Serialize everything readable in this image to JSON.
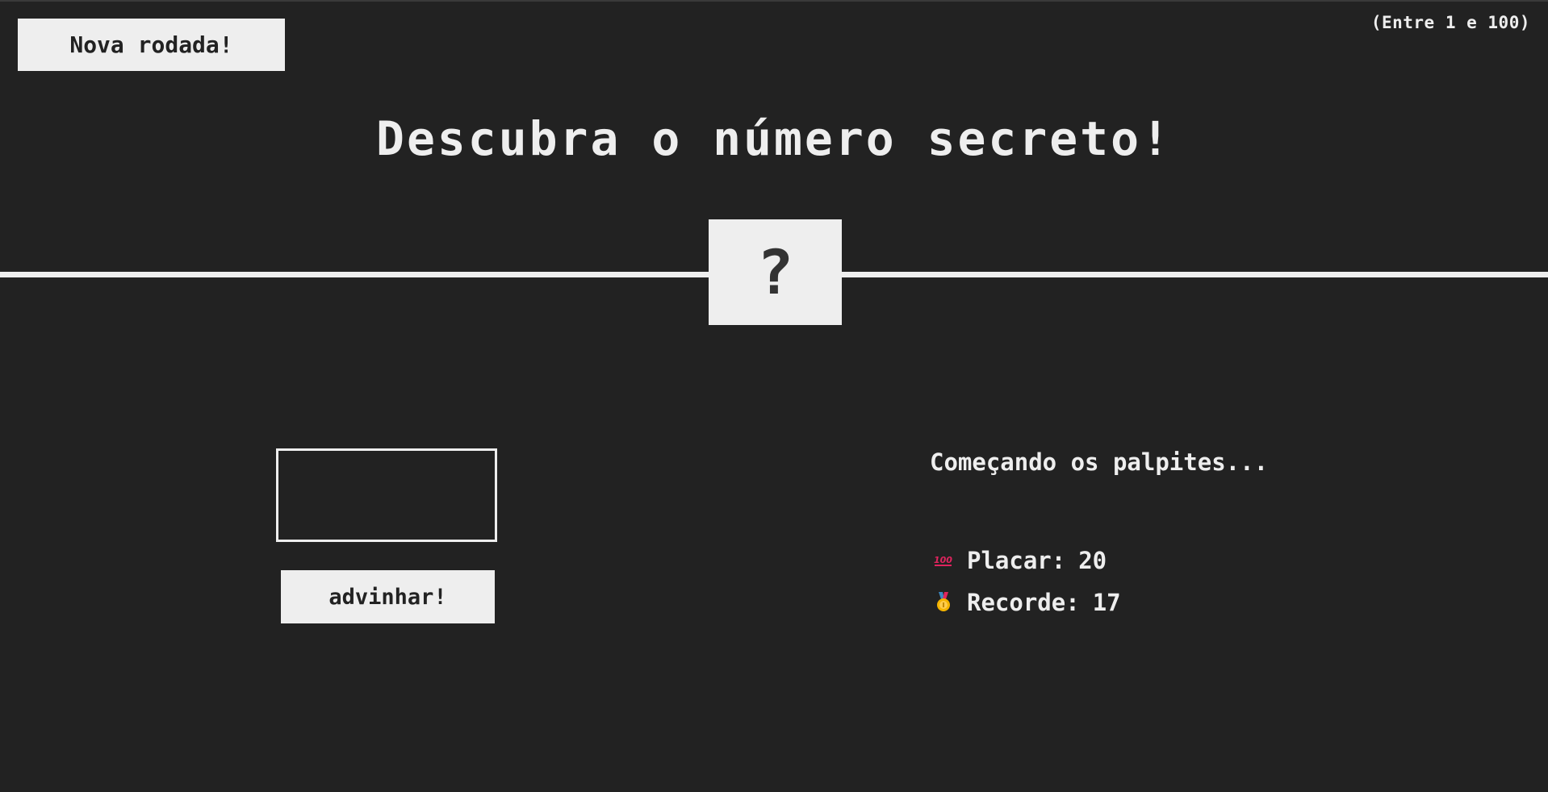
{
  "header": {
    "again_label": "Nova rodada!",
    "range_hint": "(Entre 1 e 100)"
  },
  "title": "Descubra o número secreto!",
  "secret": {
    "display": "?"
  },
  "guess": {
    "value": "",
    "check_label": "advinhar!"
  },
  "message": "Começando os palpites...",
  "stats": {
    "score_icon": "hundred-points-icon",
    "score_label": "Placar:",
    "score_value": "20",
    "highscore_icon": "medal-icon",
    "highscore_label": "Recorde:",
    "highscore_value": "17"
  },
  "colors": {
    "background": "#222222",
    "foreground": "#eeeeee",
    "score_icon": "#e0245e",
    "medal": "#f5b400",
    "medal_ribbon": "#3b88c3"
  }
}
